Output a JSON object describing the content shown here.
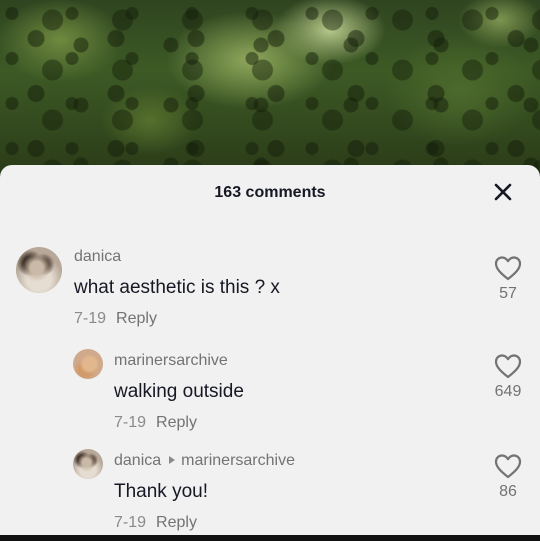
{
  "header": {
    "comment_count": "163 comments"
  },
  "comments": [
    {
      "username": "danica",
      "text": "what aesthetic is this ? x",
      "date": "7-19",
      "reply_label": "Reply",
      "likes": "57"
    },
    {
      "username": "marinersarchive",
      "text": "walking outside",
      "date": "7-19",
      "reply_label": "Reply",
      "likes": "649"
    },
    {
      "username": "danica",
      "reply_to": "marinersarchive",
      "text": "Thank you!",
      "date": "7-19",
      "reply_label": "Reply",
      "likes": "86"
    }
  ],
  "icons": {
    "close": "close-icon",
    "like": "heart-outline-icon"
  },
  "colors": {
    "sheet": "#f1f1f1",
    "text": "#161823",
    "muted": "#737373"
  }
}
